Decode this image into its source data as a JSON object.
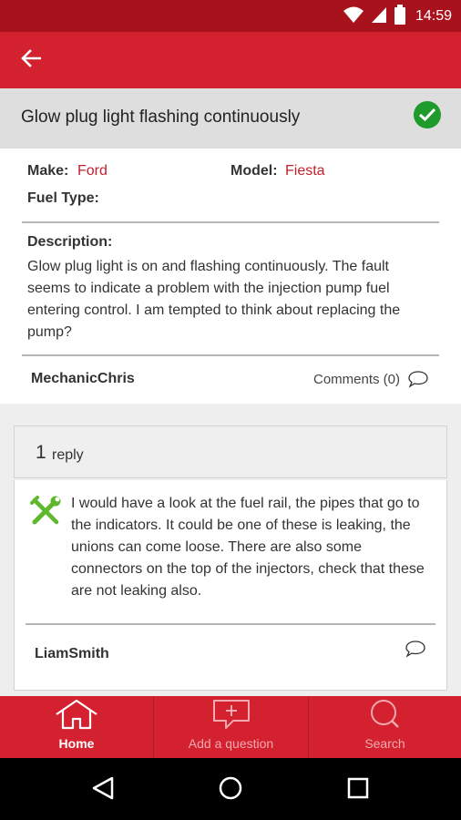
{
  "status_bar": {
    "time": "14:59",
    "icons": [
      "wifi-icon",
      "cell-signal-icon",
      "battery-icon"
    ]
  },
  "app_bar": {
    "back_icon": "back-arrow-icon"
  },
  "question": {
    "title": "Glow plug light flashing continuously",
    "solved_icon": "check-circle-icon",
    "make_label": "Make:",
    "make_value": "Ford",
    "model_label": "Model:",
    "model_value": "Fiesta",
    "fuel_label": "Fuel Type:",
    "fuel_value": "",
    "description_label": "Description:",
    "description": "Glow plug light is on and flashing continuously. The fault seems to indicate a problem with the injection pump fuel entering control. I am tempted to think about replacing the pump?",
    "author": "MechanicChris",
    "comments_label": "Comments (0)"
  },
  "replies": {
    "count": "1",
    "word": "reply",
    "items": [
      {
        "text": "I would have a look at the fuel rail, the pipes that go to the indicators. It could be one of these is leaking, the unions can come loose. There are also some connectors on the top of the injectors, check that these are not leaking also.",
        "author": "LiamSmith",
        "icon": "wrench-screwdriver-icon"
      }
    ]
  },
  "bottom_nav": {
    "items": [
      {
        "label": "Home",
        "icon": "home-icon"
      },
      {
        "label": "Add a question",
        "icon": "add-question-icon"
      },
      {
        "label": "Search",
        "icon": "search-icon"
      }
    ]
  },
  "colors": {
    "primary": "#d32130",
    "status_bar": "#a8121c",
    "accent_text": "#c3202d",
    "solved": "#1f9b2c",
    "wrench": "#5db82c"
  }
}
